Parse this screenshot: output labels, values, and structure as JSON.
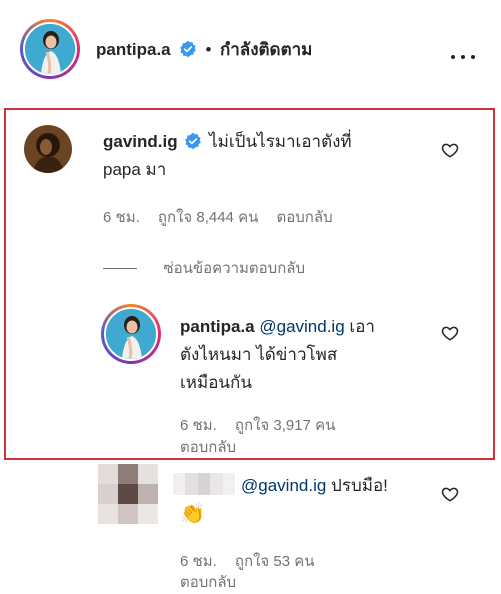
{
  "header": {
    "username": "pantipa.a",
    "separator": "•",
    "follow_status": "กำลังติดตาม"
  },
  "comments": [
    {
      "username": "gavind.ig",
      "verified": true,
      "text_line1": "ไม่เป็นไรมาเอาตังที่",
      "text_line2": "papa มา",
      "time": "6 ชม.",
      "likes": "ถูกใจ 8,444 คน",
      "reply": "ตอบกลับ",
      "hide_replies": "ซ่อนข้อความตอบกลับ"
    },
    {
      "username": "pantipa.a",
      "mention": "@gavind.ig",
      "text_line1_after": "เอา",
      "text_line2": "ตังไหนมา ได้ข่าวโพส",
      "text_line3": "เหมือนกัน",
      "time": "6 ชม.",
      "likes": "ถูกใจ 3,917 คน",
      "reply": "ตอบกลับ"
    },
    {
      "mention": "@gavind.ig",
      "text_after": "ปรบมือ!",
      "emoji": "👏",
      "time": "6 ชม.",
      "likes": "ถูกใจ 53 คน",
      "reply": "ตอบกลับ"
    }
  ],
  "colors": {
    "verified_blue": "#3897f0",
    "mention": "#00376b",
    "highlight": "#d0313a",
    "meta_gray": "#737373"
  }
}
